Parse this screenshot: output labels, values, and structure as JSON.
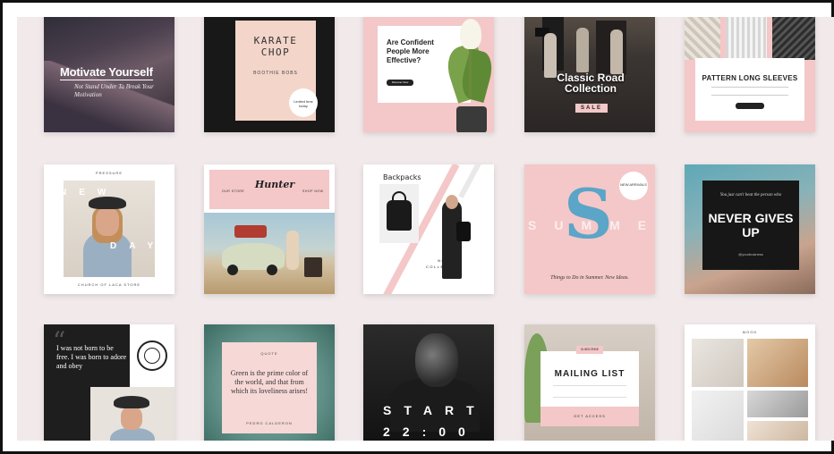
{
  "tiles": {
    "motivate": {
      "title": "Motivate Yourself",
      "subtitle": "Not Stand Under Ta Break Your Motivation"
    },
    "karate": {
      "title": "KARATE CHOP",
      "small": "BOOTHIE BOBS",
      "circle": "Limited time today"
    },
    "confident": {
      "title": "Are Confident People More Effective?",
      "button": "Discover Now"
    },
    "classic": {
      "title": "Classic Road Collection",
      "tag": "SALE"
    },
    "pattern": {
      "title": "PATTERN LONG SLEEVES"
    },
    "newday": {
      "top": "PRESSURE",
      "w1": "NEW",
      "w2": "DAY",
      "bottom": "CHURCH OF LACA STORE"
    },
    "hunter": {
      "logo": "Hunter",
      "left": "OUR STORE",
      "right": "SHOP NOW"
    },
    "backpacks": {
      "title": "Backpacks",
      "sub": "NEW COLLECTION"
    },
    "summer": {
      "letter": "S",
      "word": "SUMMER",
      "circle": "NEW ARRIVALS",
      "caption": "Things to Do in Summer. New Ideas."
    },
    "never": {
      "top": "You just can't beat the person who",
      "title": "NEVER GIVES UP",
      "handle": "@yourbusiness"
    },
    "quote": {
      "mark": "“",
      "text": "I was not born to be free. I was born to adore and obey"
    },
    "green": {
      "top": "QUOTE",
      "text": "Green is the prime color of the world, and that from which its loveliness arises!",
      "by": "PEDRO CALDERON"
    },
    "start": {
      "line1": "START",
      "line2": "22:00"
    },
    "mailing": {
      "tag": "SUBSCRIBE",
      "title": "MAILING LIST",
      "button": "GET ACCESS"
    },
    "mood": {
      "top": "MOOD"
    }
  },
  "colors": {
    "accent_pink": "#f4c7c8",
    "dark": "#181818",
    "mat": "#f1e9ea"
  }
}
